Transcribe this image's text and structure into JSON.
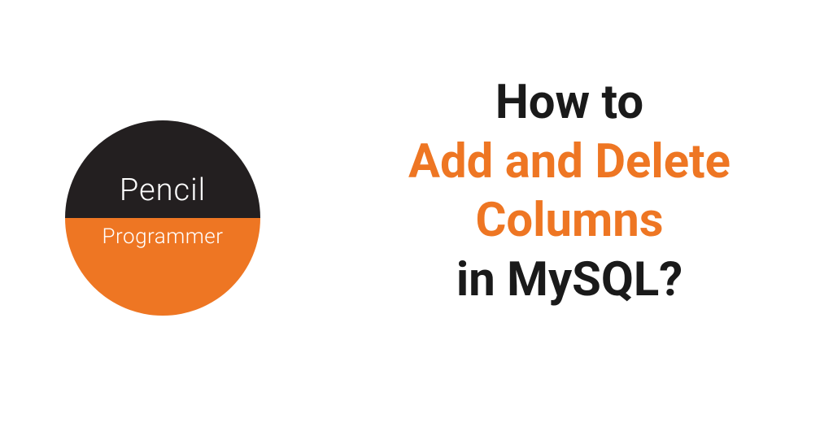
{
  "logo": {
    "top_text": "Pencil",
    "bottom_text": "Programmer"
  },
  "heading": {
    "line1": "How to",
    "line2": "Add and Delete",
    "line3": "Columns",
    "line4": "in MySQL?"
  },
  "colors": {
    "accent": "#ee7623",
    "dark": "#231f20",
    "text": "#1a1a1a"
  }
}
